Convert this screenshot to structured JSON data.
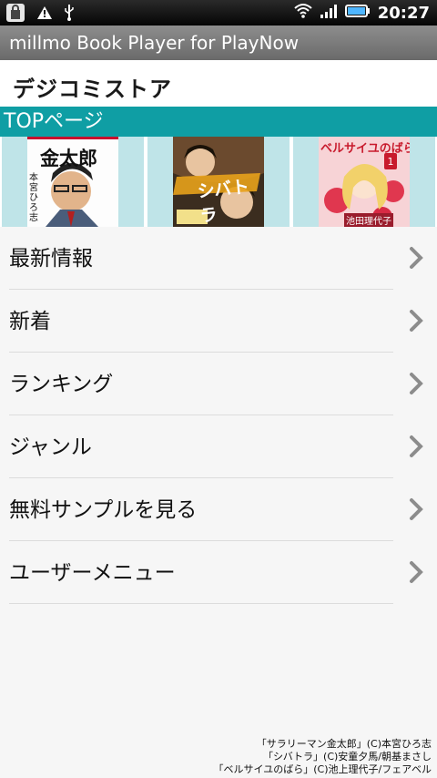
{
  "status_bar": {
    "time": "20:27",
    "icons_left": [
      "shopping-bag-icon",
      "warning-icon",
      "usb-icon"
    ],
    "icons_right": [
      "wifi-icon",
      "signal-icon",
      "battery-icon"
    ]
  },
  "title_bar": {
    "title": "millmo Book Player for PlayNow"
  },
  "store": {
    "name": "デジコミストア"
  },
  "section": {
    "label": "TOPページ"
  },
  "banner": {
    "covers": [
      {
        "title": "サラリーマン金太郎",
        "title_short": "金太郎",
        "author": "本宮ひろ志"
      },
      {
        "title": "シバトラ",
        "author": "安童夕馬/朝基まさし"
      },
      {
        "title": "ベルサイユのばら",
        "author": "池田理代子"
      }
    ]
  },
  "menu": [
    {
      "label": "最新情報"
    },
    {
      "label": "新着"
    },
    {
      "label": "ランキング"
    },
    {
      "label": "ジャンル"
    },
    {
      "label": "無料サンプルを見る"
    },
    {
      "label": "ユーザーメニュー"
    }
  ],
  "footer": {
    "lines": [
      "「サラリーマン金太郎」(C)本宮ひろ志",
      "「シバトラ」(C)安童夕馬/朝基まさし",
      "「ベルサイユのばら」(C)池上理代子/フェアベル"
    ]
  },
  "colors": {
    "accent": "#0f9ea4",
    "title_bar": "#7c7c7c",
    "banner_bg": "#bfe4e8",
    "chevron": "#8c8c8c"
  }
}
